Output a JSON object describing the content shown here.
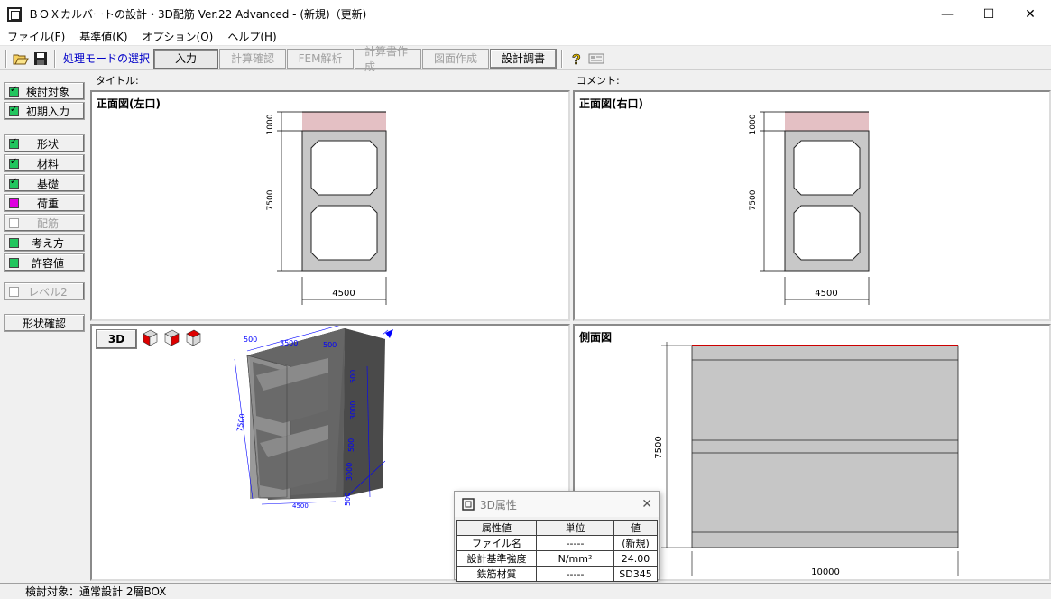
{
  "window": {
    "title": "ＢＯＸカルバートの設計・3D配筋 Ver.22 Advanced - (新規)（更新)",
    "minimize": "—",
    "maximize": "☐",
    "close": "✕"
  },
  "menu": [
    "ファイル(F)",
    "基準値(K)",
    "オプション(O)",
    "ヘルプ(H)"
  ],
  "toolbar": {
    "mode_label": "処理モードの選択",
    "modes": [
      {
        "label": "入力",
        "state": "active"
      },
      {
        "label": "計算確認",
        "state": "disabled"
      },
      {
        "label": "FEM解析",
        "state": "disabled"
      },
      {
        "label": "計算書作成",
        "state": "disabled"
      },
      {
        "label": "図面作成",
        "state": "disabled"
      },
      {
        "label": "設計調書",
        "state": "normal"
      }
    ]
  },
  "sidebar": {
    "items": [
      {
        "label": "検討対象",
        "check": "green-tick"
      },
      {
        "label": "初期入力",
        "check": "green-tick"
      },
      {
        "label": "形状",
        "check": "green-tick"
      },
      {
        "label": "材料",
        "check": "green-tick"
      },
      {
        "label": "基礎",
        "check": "green-tick"
      },
      {
        "label": "荷重",
        "check": "magenta"
      },
      {
        "label": "配筋",
        "check": "empty",
        "disabled": true
      },
      {
        "label": "考え方",
        "check": "green"
      },
      {
        "label": "許容値",
        "check": "green"
      },
      {
        "label": "レベル2",
        "check": "empty",
        "disabled": true
      }
    ],
    "shape_check": "形状確認"
  },
  "headers": {
    "title_label": "タイトル:",
    "comment_label": "コメント:"
  },
  "panes": {
    "front_left": {
      "title": "正面図(左口)",
      "dim_top": "1000",
      "dim_height": "7500",
      "dim_width": "4500"
    },
    "front_right": {
      "title": "正面図(右口)",
      "dim_top": "1000",
      "dim_height": "7500",
      "dim_width": "4500"
    },
    "view3d": {
      "button": "3D",
      "dims": {
        "a": "500",
        "b": "3500",
        "c": "500",
        "d": "500",
        "e": "3000",
        "f": "500",
        "g": "3000",
        "h": "500",
        "side": "7500",
        "bottom": "4500"
      }
    },
    "side": {
      "title": "側面図",
      "dim_height": "7500",
      "dim_width": "10000"
    }
  },
  "dialog": {
    "title": "3D属性",
    "headers": [
      "属性値",
      "単位",
      "値"
    ],
    "rows": [
      [
        "ファイル名",
        "-----",
        "(新規)"
      ],
      [
        "設計基準強度",
        "N/mm²",
        "24.00"
      ],
      [
        "鉄筋材質",
        "-----",
        "SD345"
      ]
    ]
  },
  "status": "検討対象：通常設計 2層BOX",
  "colors": {
    "pink": "#e4c0c4",
    "gray": "#c0c0c0",
    "blue": "#0000ff",
    "green": "#22c55e",
    "magenta": "#e000e0"
  }
}
